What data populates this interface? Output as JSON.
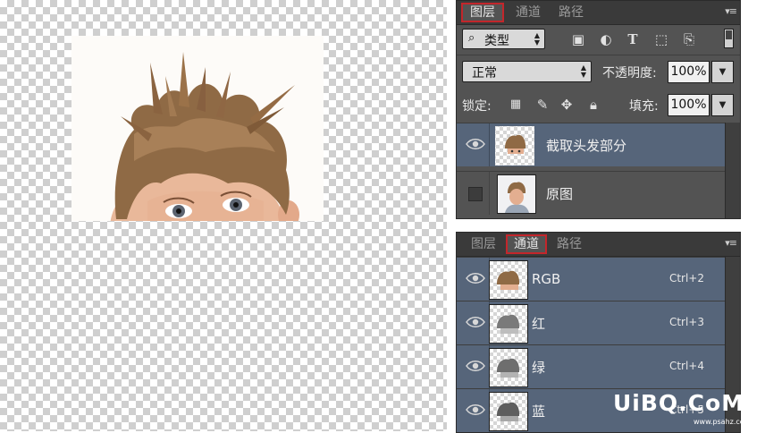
{
  "layers_panel": {
    "tabs": [
      {
        "label": "图层",
        "active": true,
        "highlighted": true
      },
      {
        "label": "通道",
        "active": false,
        "highlighted": false
      },
      {
        "label": "路径",
        "active": false,
        "highlighted": false
      }
    ],
    "filter_kind": "类型",
    "filter_icons": [
      "image-filter-icon",
      "adjustment-filter-icon",
      "text-filter-icon",
      "shape-filter-icon",
      "smart-object-filter-icon"
    ],
    "blend_mode": "正常",
    "opacity_label": "不透明度:",
    "opacity_value": "100%",
    "lock_label": "锁定:",
    "fill_label": "填充:",
    "fill_value": "100%",
    "layers": [
      {
        "name": "截取头发部分",
        "visible": true,
        "selected": true
      },
      {
        "name": "原图",
        "visible": false,
        "selected": false
      }
    ]
  },
  "channels_panel": {
    "tabs": [
      {
        "label": "图层",
        "active": false,
        "highlighted": false
      },
      {
        "label": "通道",
        "active": true,
        "highlighted": true
      },
      {
        "label": "路径",
        "active": false,
        "highlighted": false
      }
    ],
    "channels": [
      {
        "name": "RGB",
        "shortcut": "Ctrl+2"
      },
      {
        "name": "红",
        "shortcut": "Ctrl+3"
      },
      {
        "name": "绿",
        "shortcut": "Ctrl+4"
      },
      {
        "name": "蓝",
        "shortcut": "Ctrl+5"
      }
    ]
  },
  "watermark": {
    "text": "UiBQ.CoM",
    "sub": "www.psahz.com"
  },
  "colors": {
    "panel_bg": "#535353",
    "selected_row": "#56657a",
    "highlight_red": "#c3262b"
  }
}
